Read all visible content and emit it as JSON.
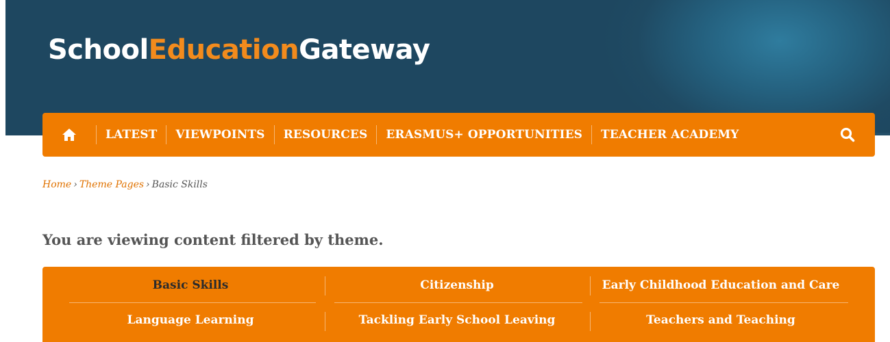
{
  "header": {
    "logo_part1": "School",
    "logo_part2": "Education",
    "logo_part3": "Gateway"
  },
  "nav": {
    "home_icon": "home-icon",
    "items": [
      {
        "label": "LATEST"
      },
      {
        "label": "VIEWPOINTS"
      },
      {
        "label": "RESOURCES"
      },
      {
        "label": "ERASMUS+ OPPORTUNITIES"
      },
      {
        "label": "TEACHER ACADEMY"
      }
    ],
    "search_icon": "search-icon"
  },
  "breadcrumb": {
    "home": "Home",
    "theme_pages": "Theme Pages",
    "current": "Basic Skills",
    "separator": "›"
  },
  "filter_heading": "You are viewing content filtered by theme.",
  "themes": {
    "items": [
      {
        "label": "Basic Skills",
        "active": true
      },
      {
        "label": "Citizenship",
        "active": false
      },
      {
        "label": "Early Childhood Education and Care",
        "active": false
      },
      {
        "label": "Language Learning",
        "active": false
      },
      {
        "label": "Tackling Early School Leaving",
        "active": false
      },
      {
        "label": "Teachers and Teaching",
        "active": false
      }
    ]
  },
  "colors": {
    "brand_orange": "#f07c00",
    "header_blue": "#1e4760",
    "text_grey": "#555555"
  }
}
